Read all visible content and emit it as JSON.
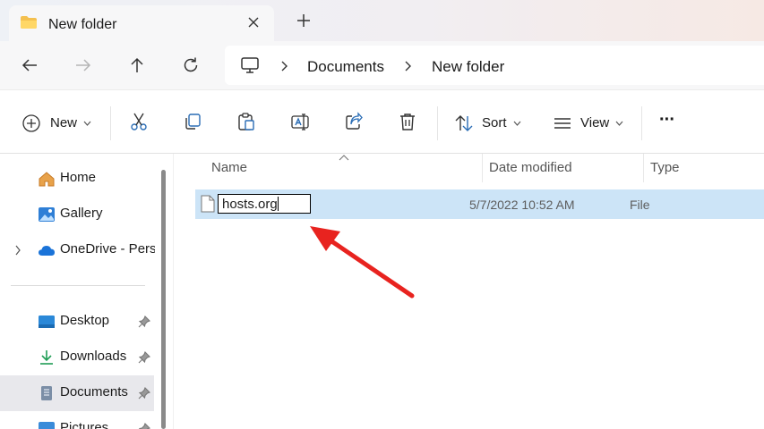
{
  "window": {
    "tab_title": "New folder",
    "new_tab_symbol": "+"
  },
  "breadcrumb": {
    "items": [
      "Documents",
      "New folder"
    ]
  },
  "toolbar": {
    "new_label": "New",
    "sort_label": "Sort",
    "view_label": "View",
    "more_label": "···"
  },
  "sidebar": {
    "items": [
      {
        "label": "Home",
        "icon": "home-icon"
      },
      {
        "label": "Gallery",
        "icon": "gallery-icon"
      },
      {
        "label": "OneDrive - Perso",
        "icon": "onedrive-icon"
      },
      {
        "label": "Desktop",
        "icon": "desktop-icon"
      },
      {
        "label": "Downloads",
        "icon": "downloads-icon"
      },
      {
        "label": "Documents",
        "icon": "documents-icon"
      },
      {
        "label": "Pictures",
        "icon": "pictures-icon"
      }
    ]
  },
  "columns": {
    "name": "Name",
    "date": "Date modified",
    "type": "Type"
  },
  "files": [
    {
      "name": "hosts.org",
      "date": "5/7/2022 10:52 AM",
      "type": "File"
    }
  ],
  "colors": {
    "selection": "#cce4f7",
    "arrow": "#e8231f",
    "accent": "#0067c0"
  }
}
